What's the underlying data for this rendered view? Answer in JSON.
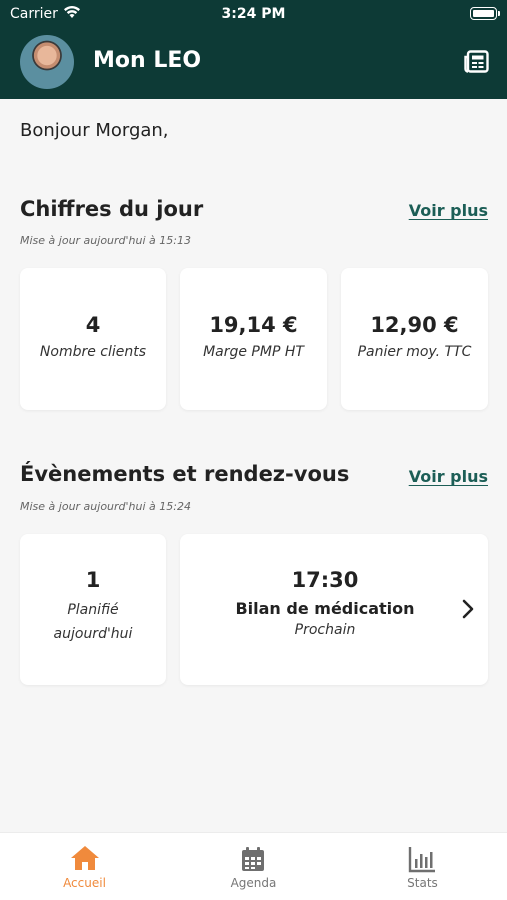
{
  "status_bar": {
    "carrier": "Carrier",
    "time": "3:24 PM"
  },
  "header": {
    "title": "Mon LEO",
    "news_icon": "newspaper-icon"
  },
  "greeting": "Bonjour Morgan,",
  "chiffres": {
    "title": "Chiffres du jour",
    "link": "Voir plus",
    "updated": "Mise à jour aujourd'hui à 15:13",
    "cards": [
      {
        "value": "4",
        "label": "Nombre clients"
      },
      {
        "value": "19,14 €",
        "label": "Marge PMP HT"
      },
      {
        "value": "12,90 €",
        "label": "Panier moy. TTC"
      }
    ]
  },
  "evenements": {
    "title": "Évènements et rendez-vous",
    "link": "Voir plus",
    "updated": "Mise à jour aujourd'hui à 15:24",
    "planned": {
      "value": "1",
      "label_line1": "Planifié",
      "label_line2": "aujourd'hui"
    },
    "next": {
      "time": "17:30",
      "title": "Bilan de médication",
      "label": "Prochain"
    }
  },
  "tabs": [
    {
      "label": "Accueil",
      "icon": "home-icon",
      "active": true
    },
    {
      "label": "Agenda",
      "icon": "calendar-icon",
      "active": false
    },
    {
      "label": "Stats",
      "icon": "stats-icon",
      "active": false
    }
  ],
  "colors": {
    "header_bg": "#0d3a36",
    "accent": "#f08a3c",
    "link": "#1c5e56"
  }
}
